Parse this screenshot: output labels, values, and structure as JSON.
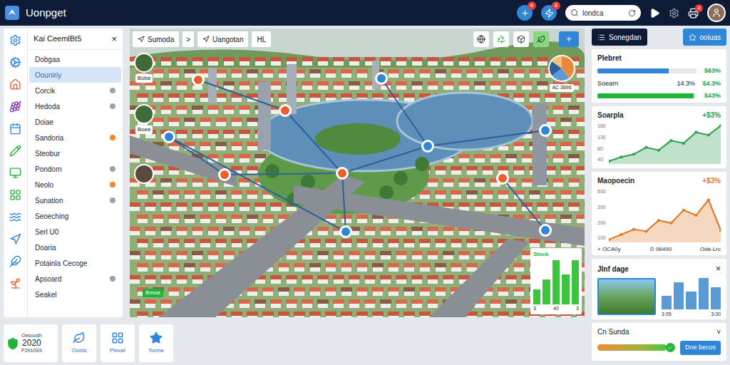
{
  "window": {
    "title": "Uonpget"
  },
  "header": {
    "notifications": [
      {
        "badge": "6"
      },
      {
        "badge": "8"
      }
    ],
    "search": {
      "value": "londca"
    },
    "printer_badge": "4"
  },
  "sidebar": {
    "title": "Kai CeemlBt5",
    "close": "×",
    "items": [
      {
        "label": "Dobgaa",
        "selected": false,
        "dot": false,
        "color": "#9ca3af"
      },
      {
        "label": "Oouniriy",
        "selected": true,
        "dot": false,
        "color": "#9ca3af"
      },
      {
        "label": "Corcik",
        "selected": false,
        "dot": true,
        "color": "#9ca3af"
      },
      {
        "label": "Hedoda",
        "selected": false,
        "dot": true,
        "color": "#9ca3af"
      },
      {
        "label": "Doiae",
        "selected": false,
        "dot": false,
        "color": "#9ca3af"
      },
      {
        "label": "Sandoria",
        "selected": false,
        "dot": true,
        "color": "#f0882c"
      },
      {
        "label": "Steobur",
        "selected": false,
        "dot": false,
        "color": "#9ca3af"
      },
      {
        "label": "Pondorn",
        "selected": false,
        "dot": true,
        "color": "#9ca3af"
      },
      {
        "label": "Neolo",
        "selected": false,
        "dot": true,
        "color": "#f0882c"
      },
      {
        "label": "Sunation",
        "selected": false,
        "dot": true,
        "color": "#9ca3af"
      },
      {
        "label": "Seoeching",
        "selected": false,
        "dot": false,
        "color": "#9ca3af"
      },
      {
        "label": "Serl U0",
        "selected": false,
        "dot": false,
        "color": "#9ca3af"
      },
      {
        "label": "Doaria",
        "selected": false,
        "dot": false,
        "color": "#9ca3af"
      },
      {
        "label": "Potainla Cecoge",
        "selected": false,
        "dot": false,
        "color": "#9ca3af"
      },
      {
        "label": "Apsoard",
        "selected": false,
        "dot": true,
        "color": "#9ca3af"
      },
      {
        "label": "Seakel",
        "selected": false,
        "dot": false,
        "color": "#9ca3af"
      }
    ]
  },
  "summary_cards": [
    {
      "kind": "badge",
      "caption": "Oesoodh",
      "value": "2020",
      "code": "P2910S9"
    },
    {
      "kind": "tile",
      "label": "Oonls"
    },
    {
      "kind": "tile",
      "label": "Pincel"
    },
    {
      "kind": "tile",
      "label": "Tonne"
    }
  ],
  "map": {
    "toolbar": {
      "crumbs": [
        "Sumoda",
        "Uangotan",
        "HL"
      ],
      "separator": ">",
      "add": "+"
    },
    "markers": [
      {
        "label": "Bobe"
      },
      {
        "label": "Boee"
      }
    ],
    "tag": "Bmoe",
    "pins": [
      {
        "color": "#e8602c"
      },
      {
        "color": "#e8602c"
      },
      {
        "color": "#e8602c"
      },
      {
        "color": "#e8602c"
      },
      {
        "color": "#2f86d6"
      },
      {
        "color": "#2f86d6"
      },
      {
        "color": "#2f86d6"
      },
      {
        "color": "#2f86d6"
      },
      {
        "color": "#e8602c"
      },
      {
        "color": "#2f86d6"
      },
      {
        "color": "#2f86d6"
      }
    ],
    "pie": {
      "label": "AC 3696",
      "slices": [
        {
          "value": 40,
          "color": "#e8893a"
        },
        {
          "value": 25,
          "color": "#5b9bd5"
        },
        {
          "value": 20,
          "color": "#2f5f9e"
        },
        {
          "value": 15,
          "color": "#f4c27a"
        }
      ]
    },
    "stat_chart": {
      "title": "Stock",
      "values": [
        3,
        5,
        9,
        6,
        9
      ],
      "labels": [
        "3",
        "40",
        "3"
      ]
    }
  },
  "actions": [
    {
      "label": "Sonegdan",
      "kind": "dark"
    },
    {
      "label": "ooiuas",
      "kind": "primary"
    }
  ],
  "progress_card": {
    "title": "Plebret",
    "rows": [
      {
        "kind": "bar",
        "level": 0.72,
        "reading": "$63%",
        "color": "#2f86d6"
      },
      {
        "kind": "text",
        "label": "Soearn",
        "value": "14.3%",
        "reading": "$4.3%"
      },
      {
        "kind": "bar",
        "level": 0.97,
        "reading": "$43%",
        "color": "#22b33a"
      }
    ]
  },
  "line_charts": [
    {
      "title": "Soarpla",
      "change": "+$3%",
      "ticks": [
        "180",
        "130",
        "80",
        "40"
      ],
      "values": [
        45,
        60,
        70,
        95,
        85,
        120,
        110,
        150,
        140,
        175
      ],
      "color": "#2e9e4f",
      "legend": []
    },
    {
      "title": "Maopoecin",
      "change": "+$3%",
      "ticks": [
        "500",
        "300",
        "200",
        "100"
      ],
      "values": [
        110,
        150,
        190,
        175,
        260,
        240,
        340,
        300,
        420,
        180
      ],
      "color": "#e07a2c",
      "legend": [
        "+ OCA0y",
        "⊙ 06490",
        "Ode-Lrc"
      ]
    }
  ],
  "gallery_card": {
    "title": "Jlnf dage",
    "close": "×",
    "bars": [
      3,
      6,
      4,
      7,
      5
    ],
    "labels": [
      "3 05",
      "3.00"
    ]
  },
  "footer_card": {
    "title": "Cn Sunda",
    "chevron": "˅",
    "level": 0.9,
    "button": "Doe becus"
  }
}
